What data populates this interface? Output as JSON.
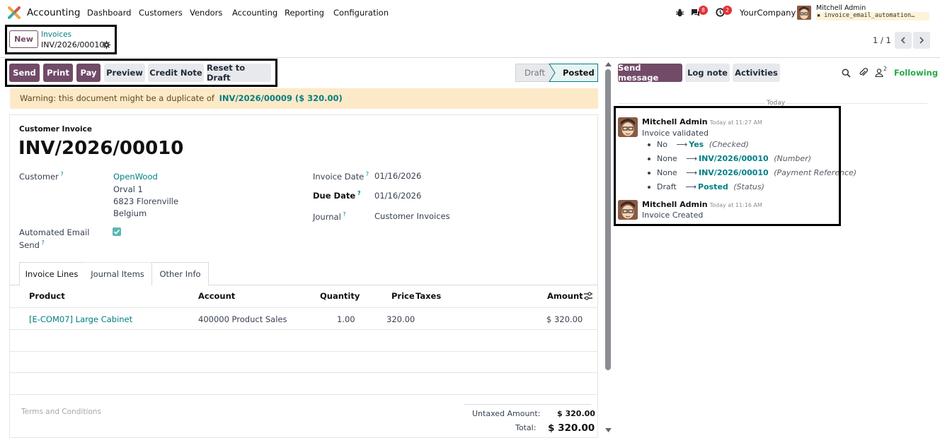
{
  "nav": {
    "app_name": "Accounting",
    "menu": [
      "Dashboard",
      "Customers",
      "Vendors",
      "Accounting",
      "Reporting",
      "Configuration"
    ],
    "messages_count": "8",
    "activities_count": "2",
    "company": "YourCompany",
    "user_name": "Mitchell Admin",
    "user_db": "invoice_email_automation…"
  },
  "breadcrumb": {
    "new_label": "New",
    "parent": "Invoices",
    "current": "INV/2026/00010",
    "pager": "1 / 1"
  },
  "actions": {
    "send": "Send",
    "print": "Print",
    "pay": "Pay",
    "preview": "Preview",
    "credit_note": "Credit Note",
    "reset_to_draft": "Reset to Draft"
  },
  "status": {
    "draft": "Draft",
    "posted": "Posted"
  },
  "warning": {
    "text": "Warning: this document might be a duplicate of",
    "link": "INV/2026/00009 ($ 320.00)"
  },
  "invoice": {
    "type_label": "Customer Invoice",
    "number": "INV/2026/00010",
    "customer_label": "Customer",
    "customer_name": "OpenWood",
    "address_line1": "Orval 1",
    "address_line2": "6823 Florenville",
    "address_line3": "Belgium",
    "auto_email_label_1": "Automated Email",
    "auto_email_label_2": "Send",
    "auto_email_checked": true,
    "invoice_date_label": "Invoice Date",
    "invoice_date": "01/16/2026",
    "due_date_label": "Due Date",
    "due_date": "01/16/2026",
    "journal_label": "Journal",
    "journal": "Customer Invoices"
  },
  "tabs": [
    "Invoice Lines",
    "Journal Items",
    "Other Info"
  ],
  "lines": {
    "headers": {
      "product": "Product",
      "account": "Account",
      "quantity": "Quantity",
      "price": "Price",
      "taxes": "Taxes",
      "amount": "Amount"
    },
    "rows": [
      {
        "product": "[E-COM07] Large Cabinet",
        "account": "400000 Product Sales",
        "quantity": "1.00",
        "price": "320.00",
        "taxes": "",
        "amount": "$ 320.00"
      }
    ]
  },
  "footer": {
    "terms_placeholder": "Terms and Conditions",
    "untaxed_label": "Untaxed Amount:",
    "untaxed_value": "$ 320.00",
    "total_label": "Total:",
    "total_value": "$ 320.00"
  },
  "chatter": {
    "send_message": "Send message",
    "log_note": "Log note",
    "activities": "Activities",
    "followers_count": "2",
    "following": "Following",
    "date_separator": "Today",
    "messages": [
      {
        "author": "Mitchell Admin",
        "time": "Today at 11:27 AM",
        "body": "Invoice validated",
        "changes": [
          {
            "old": "No",
            "new": "Yes",
            "field": "(Checked)"
          },
          {
            "old": "None",
            "new": "INV/2026/00010",
            "field": "(Number)"
          },
          {
            "old": "None",
            "new": "INV/2026/00010",
            "field": "(Payment Reference)"
          },
          {
            "old": "Draft",
            "new": "Posted",
            "field": "(Status)"
          }
        ]
      },
      {
        "author": "Mitchell Admin",
        "time": "Today at 11:16 AM",
        "body": "Invoice Created"
      }
    ]
  },
  "colors": {
    "brand": "#714b67",
    "link": "#017e84",
    "warning_bg": "#fce9c7",
    "following": "#28a745"
  }
}
